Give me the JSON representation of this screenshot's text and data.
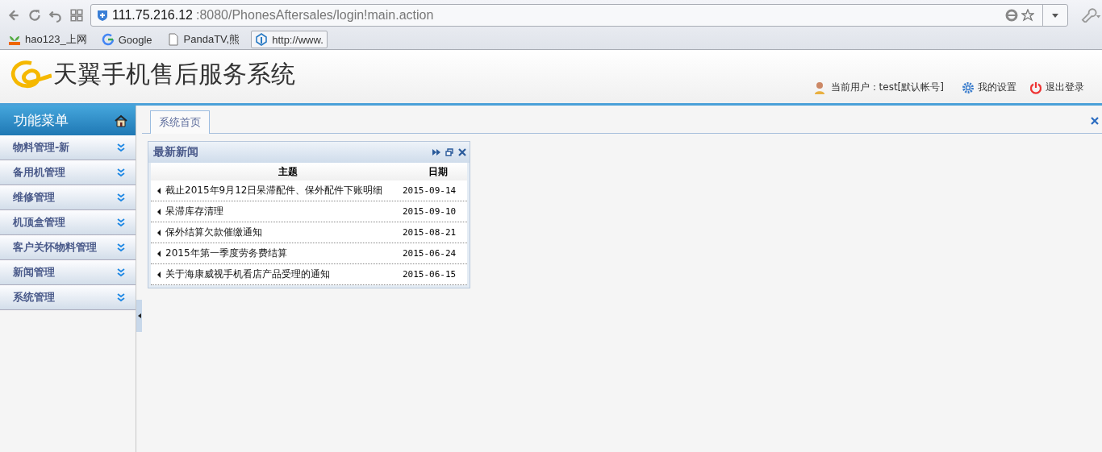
{
  "browser": {
    "url_host": "111.75.216.12",
    "url_rest": ":8080/PhonesAftersales/login!main.action",
    "bookmarks": [
      {
        "label": "hao123_上网",
        "kind": "hao"
      },
      {
        "label": "Google",
        "kind": "google"
      },
      {
        "label": "PandaTV,熊",
        "kind": "page"
      },
      {
        "label": "http://www.",
        "kind": "site"
      }
    ]
  },
  "header": {
    "title": "天翼手机售后服务系统",
    "user": "当前用户：test[默认帐号]",
    "settings": "我的设置",
    "logout": "退出登录"
  },
  "sidebar": {
    "title": "功能菜单",
    "items": [
      {
        "label": "物料管理-新"
      },
      {
        "label": "备用机管理"
      },
      {
        "label": "维修管理"
      },
      {
        "label": "机顶盒管理"
      },
      {
        "label": "客户关怀物料管理"
      },
      {
        "label": "新闻管理"
      },
      {
        "label": "系统管理"
      }
    ]
  },
  "tabs": [
    {
      "label": "系统首页",
      "selected": true
    }
  ],
  "news": {
    "title": "最新新闻",
    "columns": [
      "主题",
      "日期"
    ],
    "rows": [
      {
        "subject": "截止2015年9月12日呆滞配件、保外配件下账明细",
        "date": "2015-09-14"
      },
      {
        "subject": "呆滞库存清理",
        "date": "2015-09-10"
      },
      {
        "subject": "保外结算欠款催缴通知",
        "date": "2015-08-21"
      },
      {
        "subject": "2015年第一季度劳务费结算",
        "date": "2015-06-24"
      },
      {
        "subject": "关于海康威视手机看店产品受理的通知",
        "date": "2015-06-15"
      }
    ]
  }
}
